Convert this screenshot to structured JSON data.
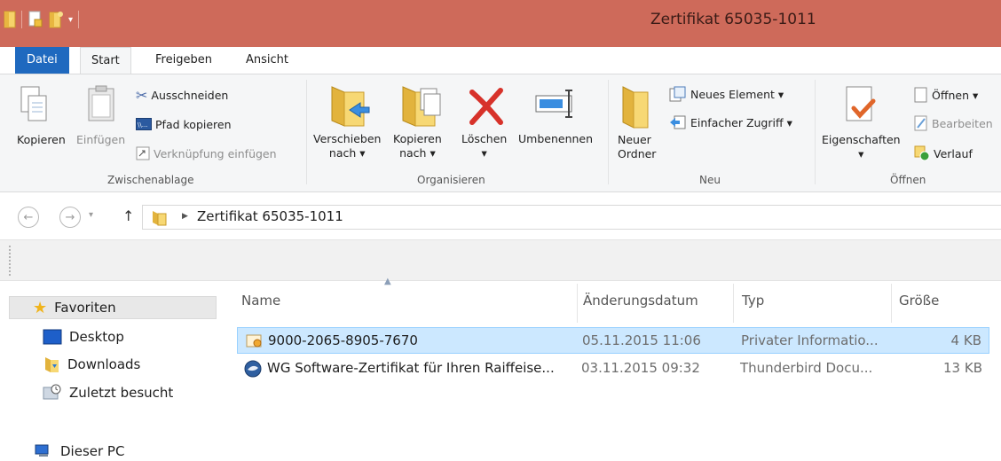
{
  "window": {
    "title": "Zertifikat 65035-1011"
  },
  "tabs": [
    {
      "label": "Datei"
    },
    {
      "label": "Start"
    },
    {
      "label": "Freigeben"
    },
    {
      "label": "Ansicht"
    }
  ],
  "ribbon": {
    "clipboard": {
      "label": "Zwischenablage",
      "copy": "Kopieren",
      "paste": "Einfügen",
      "cut": "Ausschneiden",
      "copy_path": "Pfad kopieren",
      "paste_shortcut": "Verknüpfung einfügen"
    },
    "organize": {
      "label": "Organisieren",
      "move_to_l1": "Verschieben",
      "move_to_l2": "nach ▾",
      "copy_to_l1": "Kopieren",
      "copy_to_l2": "nach ▾",
      "delete": "Löschen",
      "delete_arrow": "▾",
      "rename": "Umbenennen"
    },
    "new": {
      "label": "Neu",
      "new_folder_l1": "Neuer",
      "new_folder_l2": "Ordner",
      "new_item": "Neues Element ▾",
      "easy_access": "Einfacher Zugriff ▾"
    },
    "open": {
      "label": "Öffnen",
      "properties": "Eigenschaften",
      "properties_arrow": "▾",
      "open": "Öffnen ▾",
      "edit": "Bearbeiten",
      "history": "Verlauf"
    }
  },
  "address": {
    "path": "Zertifikat 65035-1011"
  },
  "nav": {
    "favorites": "Favoriten",
    "desktop": "Desktop",
    "downloads": "Downloads",
    "recent": "Zuletzt besucht",
    "this_pc": "Dieser PC"
  },
  "columns": {
    "name": "Name",
    "date": "Änderungsdatum",
    "type": "Typ",
    "size": "Größe"
  },
  "files": [
    {
      "name": "9000-2065-8905-7670",
      "date": "05.11.2015 11:06",
      "type": "Privater Informatio...",
      "size": "4 KB"
    },
    {
      "name": "WG Software-Zertifikat für Ihren Raiffeise...",
      "date": "03.11.2015 09:32",
      "type": "Thunderbird Docu...",
      "size": "13 KB"
    }
  ],
  "colors": {
    "titlebar": "#ce6a5a",
    "file_tab": "#1f69bf",
    "selection": "#cce8ff"
  }
}
